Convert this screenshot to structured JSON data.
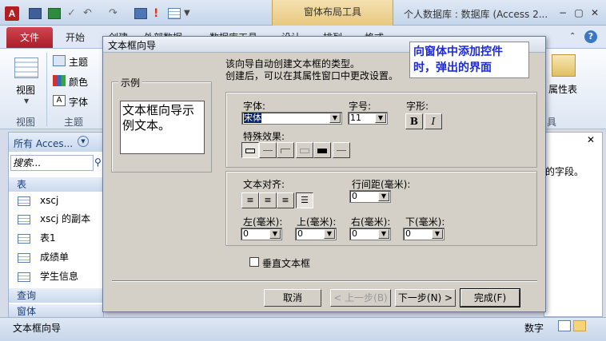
{
  "app": {
    "icon_letter": "A",
    "window_title": "个人数据库 : 数据库 (Access 2...",
    "contextual_tab": "窗体布局工具",
    "window_buttons": [
      "−",
      "▢",
      "✕"
    ]
  },
  "ribbon": {
    "tabs": [
      "文件",
      "开始",
      "创建",
      "外部数据",
      "数据库工具",
      "设计",
      "排列",
      "格式"
    ],
    "view_label": "视图",
    "theme_labels": [
      "主题",
      "颜色",
      "字体"
    ],
    "group_labels": [
      "视图",
      "主题"
    ],
    "property_sheet_label": "属性表",
    "group_tools_label": "具"
  },
  "nav": {
    "header": "所有 Acces...",
    "search_placeholder": "搜索...",
    "section_tables": "表",
    "items": [
      "xscj",
      "xscj 的副本",
      "表1",
      "成绩单",
      "学生信息"
    ],
    "section_queries": "查询",
    "section_forms": "窗体"
  },
  "prop_pane": {
    "text": "的字段。"
  },
  "status": {
    "left": "文本框向导",
    "right": "数字"
  },
  "annotation": {
    "line1": "向窗体中添加控件",
    "line2": "时，弹出的界面"
  },
  "dialog": {
    "title": "文本框向导",
    "sample_group": "示例",
    "sample_text": "文本框向导示例文本。",
    "intro_line1": "该向导自动创建文本框的类型。",
    "intro_line2": "创建后，可以在其属性窗口中更改设置。",
    "font_label": "字体:",
    "font_value": "宋体",
    "size_label": "字号:",
    "size_value": "11",
    "style_label": "字形:",
    "bold": "B",
    "italic": "I",
    "effects_label": "特殊效果:",
    "align_label": "文本对齐:",
    "line_spacing_label": "行间距(毫米):",
    "line_spacing_value": "0",
    "left_label": "左(毫米):",
    "top_label": "上(毫米):",
    "right_label": "右(毫米):",
    "bottom_label": "下(毫米):",
    "left_value": "0",
    "top_value": "0",
    "right_value": "0",
    "bottom_value": "0",
    "vertical_label": "垂直文本框",
    "cancel": "取消",
    "back": "< 上一步(B)",
    "next": "下一步(N) >",
    "finish": "完成(F)"
  }
}
